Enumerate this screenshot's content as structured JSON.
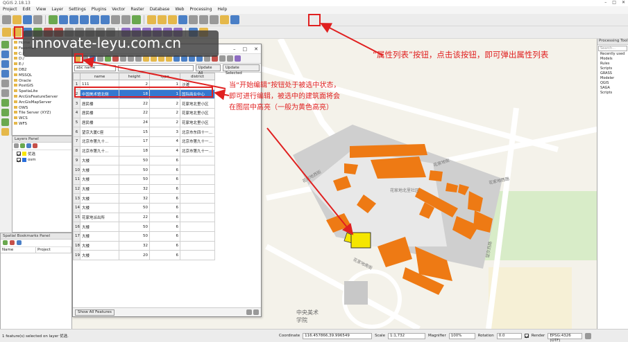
{
  "window": {
    "title": "QGIS 2.18.13"
  },
  "menu": [
    "Project",
    "Edit",
    "View",
    "Layer",
    "Settings",
    "Plugins",
    "Vector",
    "Raster",
    "Database",
    "Web",
    "Processing",
    "Help"
  ],
  "watermark": "innovate-leyu.com.cn",
  "browser_panel": {
    "items": [
      "Home",
      "Favorites",
      "C:/",
      "D:/",
      "E:/",
      "DB2",
      "MSSQL",
      "Oracle",
      "PostGIS",
      "SpatiaLite",
      "ArcGisFeatureServer",
      "ArcGisMapServer",
      "OWS",
      "Tile Server (XYZ)",
      "WCS",
      "WFS"
    ]
  },
  "layers_panel": {
    "title": "Layers Panel",
    "layers": [
      {
        "name": "优选",
        "checked": true,
        "color": "#f7e600"
      },
      {
        "name": "osm",
        "checked": true,
        "color": "#2a6fdb"
      }
    ]
  },
  "bookmarks_panel": {
    "title": "Spatial Bookmarks Panel",
    "columns": [
      "Name",
      "Project"
    ]
  },
  "attribute_table": {
    "field_select": "abc name",
    "buttons": {
      "update_all": "Update All",
      "update_selected": "Update Selected",
      "show_all": "Show All Features"
    },
    "columns": [
      "name",
      "height",
      "type",
      "district"
    ],
    "rows": [
      {
        "n": "1",
        "name": "111",
        "height": "2",
        "type": "1",
        "district": "沙滩"
      },
      {
        "n": "2",
        "name": "中国美术馆北侧",
        "height": "18",
        "type": "1",
        "district": "国际商业中心"
      },
      {
        "n": "3",
        "name": "居民楼",
        "height": "22",
        "type": "2",
        "district": "花家地北里小区"
      },
      {
        "n": "4",
        "name": "居民楼",
        "height": "22",
        "type": "2",
        "district": "花家地北里小区"
      },
      {
        "n": "5",
        "name": "居民楼",
        "height": "24",
        "type": "2",
        "district": "花家地北里小区"
      },
      {
        "n": "6",
        "name": "望京大厦C座",
        "height": "15",
        "type": "3",
        "district": "北京市东四十一…"
      },
      {
        "n": "7",
        "name": "北京市第九十…",
        "height": "17",
        "type": "4",
        "district": "北京市第九十一…"
      },
      {
        "n": "8",
        "name": "北京市第九十…",
        "height": "18",
        "type": "4",
        "district": "北京市第九十一…"
      },
      {
        "n": "9",
        "name": "大楼",
        "height": "50",
        "type": "6",
        "district": ""
      },
      {
        "n": "10",
        "name": "大楼",
        "height": "50",
        "type": "6",
        "district": ""
      },
      {
        "n": "11",
        "name": "大楼",
        "height": "50",
        "type": "6",
        "district": ""
      },
      {
        "n": "12",
        "name": "大楼",
        "height": "32",
        "type": "6",
        "district": ""
      },
      {
        "n": "13",
        "name": "大楼",
        "height": "32",
        "type": "6",
        "district": ""
      },
      {
        "n": "14",
        "name": "大楼",
        "height": "50",
        "type": "6",
        "district": ""
      },
      {
        "n": "15",
        "name": "花家地派出所",
        "height": "22",
        "type": "6",
        "district": ""
      },
      {
        "n": "16",
        "name": "大楼",
        "height": "50",
        "type": "6",
        "district": ""
      },
      {
        "n": "17",
        "name": "大楼",
        "height": "50",
        "type": "6",
        "district": ""
      },
      {
        "n": "18",
        "name": "大楼",
        "height": "32",
        "type": "6",
        "district": ""
      },
      {
        "n": "19",
        "name": "大楼",
        "height": "20",
        "type": "6",
        "district": ""
      }
    ]
  },
  "map": {
    "labels": [
      "花家地北里社区",
      "花家地街",
      "花家地西街",
      "中央美术学院",
      "花家地西路",
      "花家地南街",
      "望京西路"
    ]
  },
  "right_panel": {
    "title": "Processing Toolbox",
    "search_placeholder": "Search...",
    "items": [
      "Recently used",
      "Models",
      "Rules",
      "Scripts",
      "GRASS",
      "Modeler",
      "QGIS",
      "SAGA",
      "Scripts"
    ]
  },
  "annotations": {
    "attr_button": "“属性列表”按钮，点击该按钮，即可弹出属性列表",
    "edit_button": "当“开始编辑”按钮处于被选中状态，即可进行编辑，被选中的建筑面将会在图层中高亮（一般为黄色高亮）"
  },
  "statusbar": {
    "message": "1 feature(s) selected on layer 优选.",
    "coordinate_label": "Coordinate",
    "coordinate": "116.457866,39.996549",
    "scale_label": "Scale",
    "scale": "1:1,732",
    "magnifier_label": "Magnifier",
    "magnifier": "100%",
    "rotation_label": "Rotation",
    "rotation": "0.0",
    "render_label": "Render",
    "crs": "EPSG:4326 (OTF)"
  }
}
